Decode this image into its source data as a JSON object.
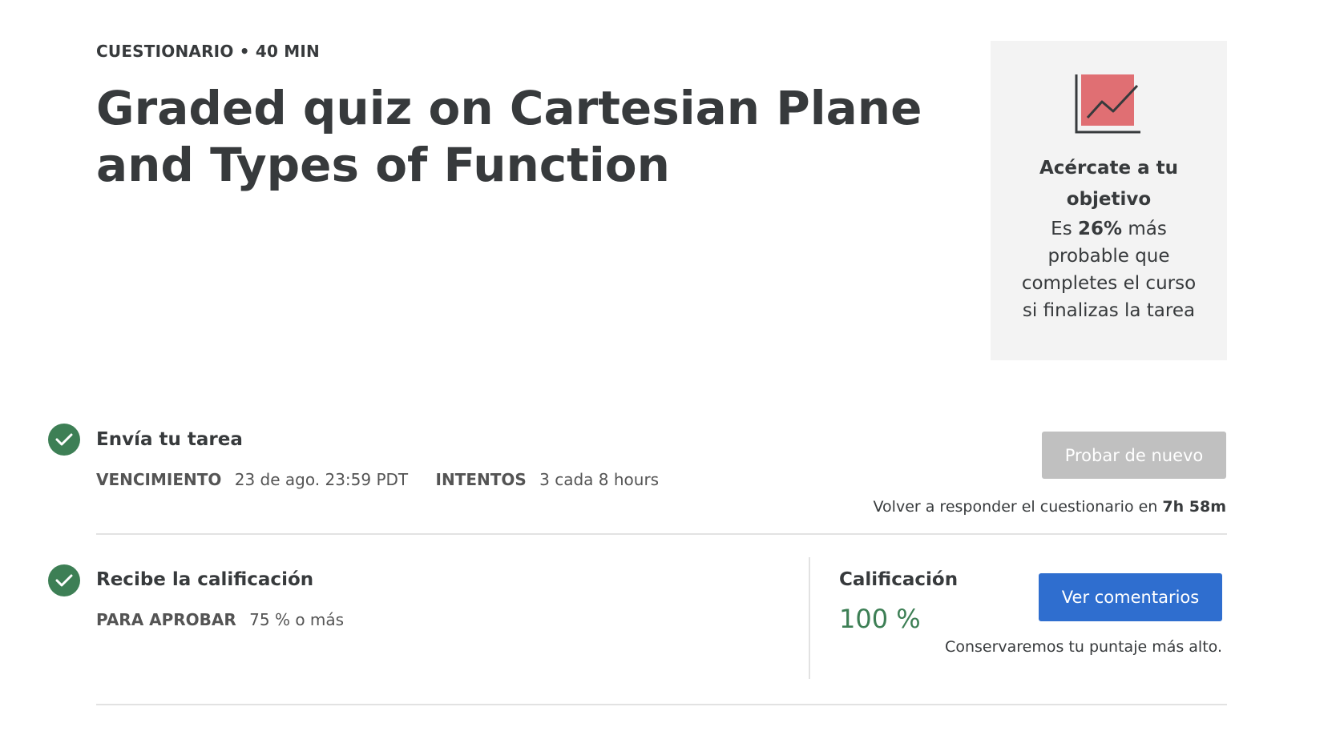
{
  "header": {
    "eyebrow": "CUESTIONARIO • 40 MIN",
    "title": "Graded quiz on Cartesian Plane and Types of Function"
  },
  "goal_card": {
    "icon": "trend-chart-icon",
    "title_line1": "Acércate a tu",
    "title_line2": "objetivo",
    "body_prefix": "Es ",
    "body_percent": "26%",
    "body_suffix_line1": " más",
    "body_line2": "probable que",
    "body_line3": "completes el curso",
    "body_line4": "si finalizas la tarea",
    "background": "#f3f3f3",
    "icon_color": "#e06f73"
  },
  "submit_step": {
    "icon": "check-circle-icon",
    "title": "Envía tu tarea",
    "due_label": "VENCIMIENTO",
    "due_value": "23 de ago. 23:59 PDT",
    "attempts_label": "INTENTOS",
    "attempts_value": "3 cada 8 hours",
    "retry_button": "Probar de nuevo",
    "retry_note_prefix": "Volver a responder el cuestionario en ",
    "retry_note_time": "7h 58m"
  },
  "grade_step": {
    "icon": "check-circle-icon",
    "title": "Recibe la calificación",
    "pass_label": "PARA APROBAR",
    "pass_value": "75 % o más",
    "grade_label": "Calificación",
    "grade_value": "100 %",
    "feedback_button": "Ver comentarios",
    "keep_note": "Conservaremos tu puntaje más alto."
  },
  "colors": {
    "success": "#3d7f55",
    "primary": "#2f6ecf",
    "disabled": "#c0c0c0",
    "text": "#373a3c"
  }
}
